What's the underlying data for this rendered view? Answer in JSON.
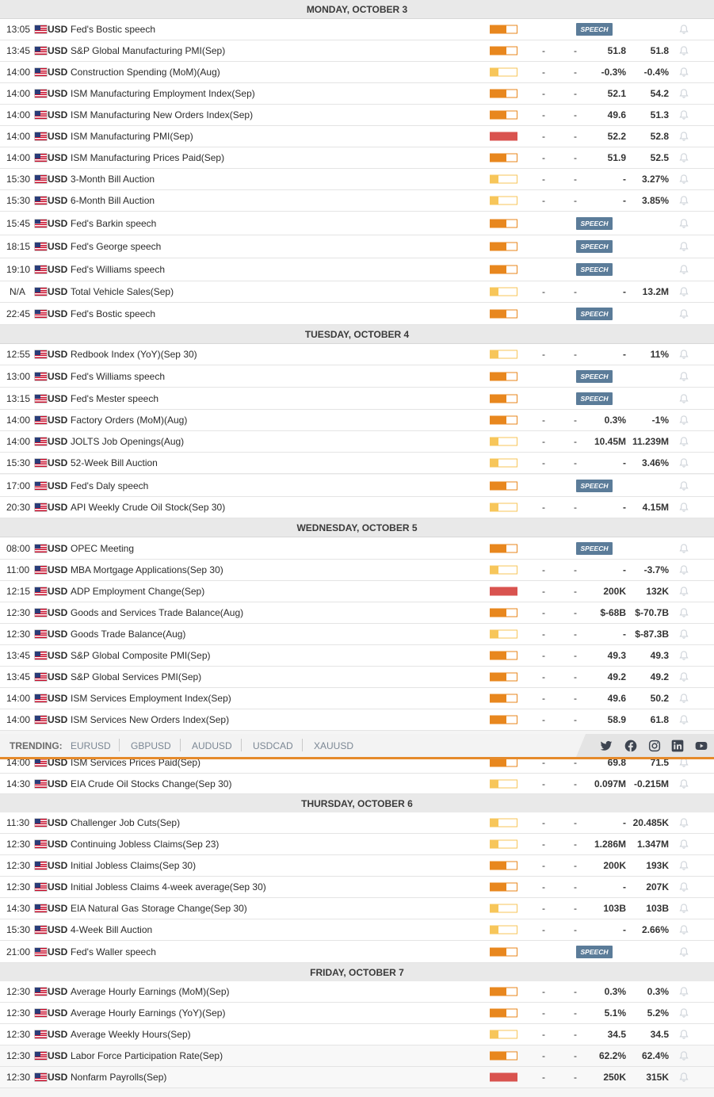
{
  "days": [
    {
      "header": "MONDAY, OCTOBER 3",
      "rows": [
        {
          "time": "13:05",
          "currency": "USD",
          "event": "Fed's Bostic speech",
          "impact": "medium",
          "speech": true
        },
        {
          "time": "13:45",
          "currency": "USD",
          "event": "S&P Global Manufacturing PMI(Sep)",
          "impact": "medium",
          "actual": "-",
          "forecast_dash": "-",
          "forecast": "51.8",
          "previous": "51.8"
        },
        {
          "time": "14:00",
          "currency": "USD",
          "event": "Construction Spending (MoM)(Aug)",
          "impact": "low",
          "actual": "-",
          "forecast_dash": "-",
          "forecast": "-0.3%",
          "previous": "-0.4%"
        },
        {
          "time": "14:00",
          "currency": "USD",
          "event": "ISM Manufacturing Employment Index(Sep)",
          "impact": "medium",
          "actual": "-",
          "forecast_dash": "-",
          "forecast": "52.1",
          "previous": "54.2"
        },
        {
          "time": "14:00",
          "currency": "USD",
          "event": "ISM Manufacturing New Orders Index(Sep)",
          "impact": "medium",
          "actual": "-",
          "forecast_dash": "-",
          "forecast": "49.6",
          "previous": "51.3"
        },
        {
          "time": "14:00",
          "currency": "USD",
          "event": "ISM Manufacturing PMI(Sep)",
          "impact": "high",
          "actual": "-",
          "forecast_dash": "-",
          "forecast": "52.2",
          "previous": "52.8"
        },
        {
          "time": "14:00",
          "currency": "USD",
          "event": "ISM Manufacturing Prices Paid(Sep)",
          "impact": "medium",
          "actual": "-",
          "forecast_dash": "-",
          "forecast": "51.9",
          "previous": "52.5"
        },
        {
          "time": "15:30",
          "currency": "USD",
          "event": "3-Month Bill Auction",
          "impact": "low",
          "actual": "-",
          "forecast_dash": "-",
          "forecast": "-",
          "previous": "3.27%"
        },
        {
          "time": "15:30",
          "currency": "USD",
          "event": "6-Month Bill Auction",
          "impact": "low",
          "actual": "-",
          "forecast_dash": "-",
          "forecast": "-",
          "previous": "3.85%"
        },
        {
          "time": "15:45",
          "currency": "USD",
          "event": "Fed's Barkin speech",
          "impact": "medium",
          "speech": true
        },
        {
          "time": "18:15",
          "currency": "USD",
          "event": "Fed's George speech",
          "impact": "medium",
          "speech": true
        },
        {
          "time": "19:10",
          "currency": "USD",
          "event": "Fed's Williams speech",
          "impact": "medium",
          "speech": true
        },
        {
          "time": "N/A",
          "currency": "USD",
          "event": "Total Vehicle Sales(Sep)",
          "impact": "low",
          "actual": "-",
          "forecast_dash": "-",
          "forecast": "-",
          "previous": "13.2M"
        },
        {
          "time": "22:45",
          "currency": "USD",
          "event": "Fed's Bostic speech",
          "impact": "medium",
          "speech": true
        }
      ]
    },
    {
      "header": "TUESDAY, OCTOBER 4",
      "rows": [
        {
          "time": "12:55",
          "currency": "USD",
          "event": "Redbook Index (YoY)(Sep 30)",
          "impact": "low",
          "actual": "-",
          "forecast_dash": "-",
          "forecast": "-",
          "previous": "11%"
        },
        {
          "time": "13:00",
          "currency": "USD",
          "event": "Fed's Williams speech",
          "impact": "medium",
          "speech": true
        },
        {
          "time": "13:15",
          "currency": "USD",
          "event": "Fed's Mester speech",
          "impact": "medium",
          "speech": true
        },
        {
          "time": "14:00",
          "currency": "USD",
          "event": "Factory Orders (MoM)(Aug)",
          "impact": "medium",
          "actual": "-",
          "forecast_dash": "-",
          "forecast": "0.3%",
          "previous": "-1%"
        },
        {
          "time": "14:00",
          "currency": "USD",
          "event": "JOLTS Job Openings(Aug)",
          "impact": "low",
          "actual": "-",
          "forecast_dash": "-",
          "forecast": "10.45M",
          "previous": "11.239M"
        },
        {
          "time": "15:30",
          "currency": "USD",
          "event": "52-Week Bill Auction",
          "impact": "low",
          "actual": "-",
          "forecast_dash": "-",
          "forecast": "-",
          "previous": "3.46%"
        },
        {
          "time": "17:00",
          "currency": "USD",
          "event": "Fed's Daly speech",
          "impact": "medium",
          "speech": true
        },
        {
          "time": "20:30",
          "currency": "USD",
          "event": "API Weekly Crude Oil Stock(Sep 30)",
          "impact": "low",
          "actual": "-",
          "forecast_dash": "-",
          "forecast": "-",
          "previous": "4.15M"
        }
      ]
    },
    {
      "header": "WEDNESDAY, OCTOBER 5",
      "rows": [
        {
          "time": "08:00",
          "currency": "USD",
          "event": "OPEC Meeting",
          "impact": "medium",
          "speech": true
        },
        {
          "time": "11:00",
          "currency": "USD",
          "event": "MBA Mortgage Applications(Sep 30)",
          "impact": "low",
          "actual": "-",
          "forecast_dash": "-",
          "forecast": "-",
          "previous": "-3.7%"
        },
        {
          "time": "12:15",
          "currency": "USD",
          "event": "ADP Employment Change(Sep)",
          "impact": "high",
          "actual": "-",
          "forecast_dash": "-",
          "forecast": "200K",
          "previous": "132K"
        },
        {
          "time": "12:30",
          "currency": "USD",
          "event": "Goods and Services Trade Balance(Aug)",
          "impact": "medium",
          "actual": "-",
          "forecast_dash": "-",
          "forecast": "$-68B",
          "previous": "$-70.7B"
        },
        {
          "time": "12:30",
          "currency": "USD",
          "event": "Goods Trade Balance(Aug)",
          "impact": "low",
          "actual": "-",
          "forecast_dash": "-",
          "forecast": "-",
          "previous": "$-87.3B"
        },
        {
          "time": "13:45",
          "currency": "USD",
          "event": "S&P Global Composite PMI(Sep)",
          "impact": "medium",
          "actual": "-",
          "forecast_dash": "-",
          "forecast": "49.3",
          "previous": "49.3"
        },
        {
          "time": "13:45",
          "currency": "USD",
          "event": "S&P Global Services PMI(Sep)",
          "impact": "medium",
          "actual": "-",
          "forecast_dash": "-",
          "forecast": "49.2",
          "previous": "49.2"
        },
        {
          "time": "14:00",
          "currency": "USD",
          "event": "ISM Services Employment Index(Sep)",
          "impact": "medium",
          "actual": "-",
          "forecast_dash": "-",
          "forecast": "49.6",
          "previous": "50.2"
        },
        {
          "time": "14:00",
          "currency": "USD",
          "event": "ISM Services New Orders Index(Sep)",
          "impact": "medium",
          "actual": "-",
          "forecast_dash": "-",
          "forecast": "58.9",
          "previous": "61.8"
        },
        {
          "time": "14:00",
          "currency": "USD",
          "event": "ISM Services Prices Paid(Sep)",
          "impact": "medium",
          "actual": "-",
          "forecast_dash": "-",
          "forecast": "69.8",
          "previous": "71.5"
        },
        {
          "time": "14:30",
          "currency": "USD",
          "event": "EIA Crude Oil Stocks Change(Sep 30)",
          "impact": "low",
          "actual": "-",
          "forecast_dash": "-",
          "forecast": "0.097M",
          "previous": "-0.215M"
        }
      ]
    },
    {
      "header": "THURSDAY, OCTOBER 6",
      "rows": [
        {
          "time": "11:30",
          "currency": "USD",
          "event": "Challenger Job Cuts(Sep)",
          "impact": "low",
          "actual": "-",
          "forecast_dash": "-",
          "forecast": "-",
          "previous": "20.485K"
        },
        {
          "time": "12:30",
          "currency": "USD",
          "event": "Continuing Jobless Claims(Sep 23)",
          "impact": "low",
          "actual": "-",
          "forecast_dash": "-",
          "forecast": "1.286M",
          "previous": "1.347M"
        },
        {
          "time": "12:30",
          "currency": "USD",
          "event": "Initial Jobless Claims(Sep 30)",
          "impact": "medium",
          "actual": "-",
          "forecast_dash": "-",
          "forecast": "200K",
          "previous": "193K"
        },
        {
          "time": "12:30",
          "currency": "USD",
          "event": "Initial Jobless Claims 4-week average(Sep 30)",
          "impact": "medium",
          "actual": "-",
          "forecast_dash": "-",
          "forecast": "-",
          "previous": "207K"
        },
        {
          "time": "14:30",
          "currency": "USD",
          "event": "EIA Natural Gas Storage Change(Sep 30)",
          "impact": "low",
          "actual": "-",
          "forecast_dash": "-",
          "forecast": "103B",
          "previous": "103B"
        },
        {
          "time": "15:30",
          "currency": "USD",
          "event": "4-Week Bill Auction",
          "impact": "low",
          "actual": "-",
          "forecast_dash": "-",
          "forecast": "-",
          "previous": "2.66%"
        },
        {
          "time": "21:00",
          "currency": "USD",
          "event": "Fed's Waller speech",
          "impact": "medium",
          "speech": true
        }
      ]
    },
    {
      "header": "FRIDAY, OCTOBER 7",
      "rows": [
        {
          "time": "12:30",
          "currency": "USD",
          "event": "Average Hourly Earnings (MoM)(Sep)",
          "impact": "medium",
          "actual": "-",
          "forecast_dash": "-",
          "forecast": "0.3%",
          "previous": "0.3%"
        },
        {
          "time": "12:30",
          "currency": "USD",
          "event": "Average Hourly Earnings (YoY)(Sep)",
          "impact": "medium",
          "actual": "-",
          "forecast_dash": "-",
          "forecast": "5.1%",
          "previous": "5.2%"
        },
        {
          "time": "12:30",
          "currency": "USD",
          "event": "Average Weekly Hours(Sep)",
          "impact": "low",
          "actual": "-",
          "forecast_dash": "-",
          "forecast": "34.5",
          "previous": "34.5"
        },
        {
          "time": "12:30",
          "currency": "USD",
          "event": "Labor Force Participation Rate(Sep)",
          "impact": "medium",
          "actual": "-",
          "forecast_dash": "-",
          "forecast": "62.2%",
          "previous": "62.4%"
        },
        {
          "time": "12:30",
          "currency": "USD",
          "event": "Nonfarm Payrolls(Sep)",
          "impact": "high",
          "actual": "-",
          "forecast_dash": "-",
          "forecast": "250K",
          "previous": "315K"
        }
      ]
    }
  ],
  "speech_label": "SPEECH",
  "impact_colors": {
    "low": "#f7c65a",
    "medium": "#e8871e",
    "high": "#d9534f"
  },
  "impact_levels": {
    "low": 0.3,
    "medium": 0.6,
    "high": 1.0
  },
  "trending": {
    "label": "TRENDING:",
    "links": [
      "EURUSD",
      "GBPUSD",
      "AUDUSD",
      "USDCAD",
      "XAUUSD"
    ]
  },
  "social_icons": [
    "twitter-icon",
    "facebook-icon",
    "instagram-icon",
    "linkedin-icon",
    "youtube-icon"
  ],
  "accent_color": "#e58a2b"
}
